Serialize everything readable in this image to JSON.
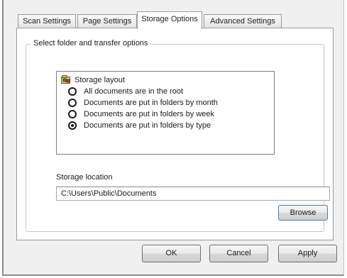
{
  "tabs": [
    {
      "label": "Scan Settings",
      "active": false
    },
    {
      "label": "Page Settings",
      "active": false
    },
    {
      "label": "Storage Options",
      "active": true
    },
    {
      "label": "Advanced Settings",
      "active": false
    }
  ],
  "group": {
    "legend": "Select folder and transfer options"
  },
  "storage_layout": {
    "title": "Storage layout",
    "icon": "storage-layout-icon",
    "options": [
      {
        "label": "All documents are in the root",
        "checked": false
      },
      {
        "label": "Documents are put in folders by month",
        "checked": false
      },
      {
        "label": "Documents are put in folders by week",
        "checked": false
      },
      {
        "label": "Documents are put in folders by type",
        "checked": true
      }
    ]
  },
  "storage_location": {
    "label": "Storage location",
    "value": "C:\\Users\\Public\\Documents",
    "browse_label": "Browse"
  },
  "footer": {
    "ok_label": "OK",
    "cancel_label": "Cancel",
    "apply_label": "Apply"
  }
}
